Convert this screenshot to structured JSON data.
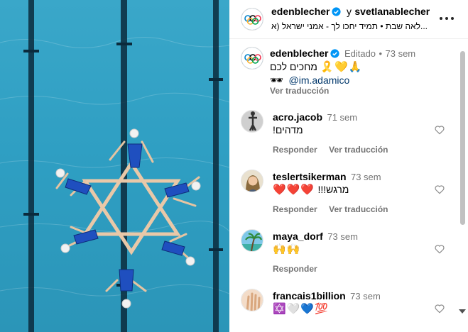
{
  "header": {
    "username": "edenblecher",
    "connector": "y",
    "coauthor": "svetlanablecher",
    "subtitle": "לאה שבת • תמיד יחכו לך - אמני ישראל (א..."
  },
  "caption": {
    "username": "edenblecher",
    "edited": "Editado",
    "dot": "•",
    "time": "73 sem",
    "text": "מחכים לכם",
    "emojis": "🎗️💛🙏",
    "mention_emoji": "🕶",
    "mention": "@im.adamico",
    "translate": "Ver traducción"
  },
  "comments": [
    {
      "username": "acro.jacob",
      "time": "71 sem",
      "text": "מדהים!",
      "emojis": "",
      "reply": "Responder",
      "translate": "Ver traducción"
    },
    {
      "username": "teslertsikerman",
      "time": "73 sem",
      "text": "מרגש!!!",
      "emojis": "❤️❤️❤️",
      "reply": "Responder",
      "translate": "Ver traducción"
    },
    {
      "username": "maya_dorf",
      "time": "73 sem",
      "text": "",
      "emojis": "🙌🙌",
      "reply": "Responder",
      "translate": ""
    },
    {
      "username": "francais1billion",
      "time": "73 sem",
      "text": "",
      "emojis": "✡️🤍💙💯",
      "reply": "",
      "translate": ""
    }
  ],
  "icons": {
    "more": "more-options-icon",
    "like": "heart-outline-icon",
    "verified": "verified-badge-icon"
  },
  "colors": {
    "pool": "#2f9fc3",
    "verified": "#0095f6",
    "muted": "#737373",
    "mention": "#00376b",
    "swimsuit": "#1f4fbf"
  }
}
